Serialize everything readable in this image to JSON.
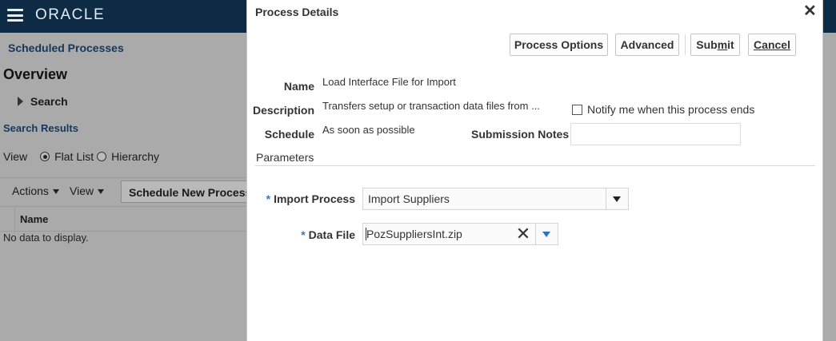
{
  "app": {
    "logo": "ORACLE"
  },
  "background": {
    "breadcrumb": "Scheduled Processes",
    "overview": "Overview",
    "search": "Search",
    "search_results": "Search Results",
    "view_label": "View",
    "view_options": [
      "Flat List",
      "Hierarchy"
    ],
    "toolbar": {
      "actions": "Actions",
      "view": "View",
      "schedule_new_process": "Schedule New Process"
    },
    "table": {
      "columns": [
        "Name"
      ],
      "empty_text": "No data to display."
    }
  },
  "dialog": {
    "title": "Process Details",
    "close_icon": "close-icon",
    "buttons": {
      "process_options": "Process Options",
      "advanced": "Advanced",
      "submit_prefix": "Sub",
      "submit_underline": "m",
      "submit_suffix": "it",
      "cancel_underline": "C",
      "cancel_suffix": "ancel"
    },
    "fields": {
      "name_label": "Name",
      "name_value": "Load Interface File for Import",
      "description_label": "Description",
      "description_value": "Transfers setup or transaction data files from ...",
      "schedule_label": "Schedule",
      "schedule_value": "As soon as possible",
      "notify_label": "Notify me when this process ends",
      "submission_notes_label": "Submission Notes",
      "submission_notes_value": ""
    },
    "parameters": {
      "heading": "Parameters",
      "required_marker": "*",
      "import_process_label": "Import Process",
      "import_process_value": "Import Suppliers",
      "data_file_label": "Data File",
      "data_file_value": "PozSuppliersInt.zip"
    }
  },
  "colors": {
    "header_bg": "#0d2b45",
    "required_marker": "#3b73c3",
    "dropdown_accent": "#2a74c4"
  }
}
